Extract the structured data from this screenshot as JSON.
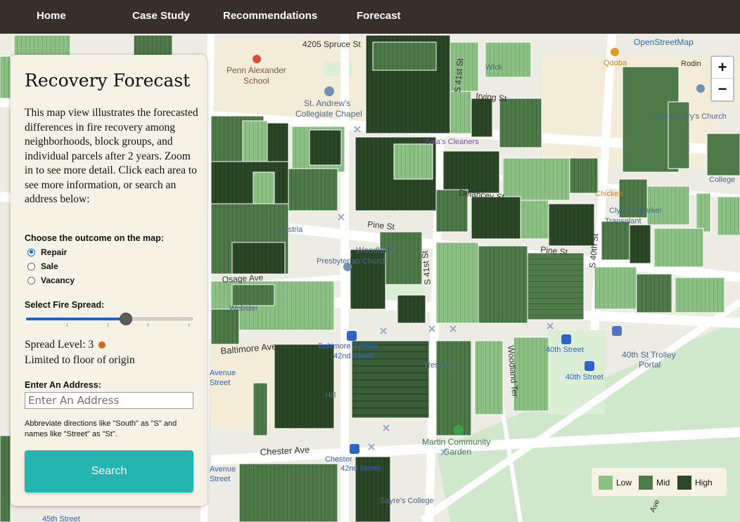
{
  "nav": {
    "home": "Home",
    "case_study": "Case Study",
    "recommendations": "Recommendations",
    "forecast": "Forecast"
  },
  "map": {
    "attribution": "OpenStreetMap",
    "zoom_in": "+",
    "zoom_out": "−",
    "labels": {
      "spruce": "4205 Spruce St",
      "penn_alexander": "Penn Alexander",
      "school": "School",
      "st_andrews": "St. Andrew's",
      "collegiate_chapel": "Collegiate Chapel",
      "s41_north": "S 41st St",
      "irving": "Irving St",
      "saias": "Saia's Cleaners",
      "delancey": "Delancey St",
      "pine_left": "Pine St",
      "pine_right": "Pine St",
      "woodland": "Woodland",
      "presbyterian": "Presbyterian Church",
      "s41_mid": "S 41st St",
      "s40": "S 40th St",
      "osage": "Osage Ave",
      "baltimore": "Baltimore Ave",
      "baltimore_42": "Baltimore Avenue",
      "baltimore_42b": "42nd Street",
      "woodland_ter": "Woodland Ter",
      "st40_top": "40th Street",
      "st40_bottom": "40th Street",
      "trolley": "40th St Trolley",
      "portal": "Portal",
      "chester": "Chester Ave",
      "chester_42": "Chester",
      "chester_42b": "42nd Street",
      "martin": "Martin Community",
      "garden": "Garden",
      "college": "Sayre's College",
      "qdoba": "Qdoba",
      "rodin": "Rodin",
      "st_marys": "Saint Mary's Church",
      "college_r": "College",
      "clyde": "Clyde F. Barker",
      "transplant": "Transplant",
      "avenue_l": "Avenue",
      "street_l": "Street",
      "avenue_l2": "Avenue",
      "street_l2": "Street",
      "street_bottom": "45th Street",
      "ave_bot": "Ave",
      "webs": "Webster",
      "resc": "Rescue",
      "hill": "Hill",
      "kwick": "Wick",
      "chicken": "Chicken",
      "ustria": "Austria"
    }
  },
  "panel": {
    "title": "Recovery Forecast",
    "description": "This map view illustrates the forecasted differences in fire recovery among neighborhoods, block groups, and individual parcels after 2 years. Zoom in to see more detail. Click each area to see more information, or search an address below:",
    "outcome_label": "Choose the outcome on the map:",
    "outcomes": [
      "Repair",
      "Sale",
      "Vacancy"
    ],
    "selected_outcome": "Repair",
    "spread_label": "Select Fire Spread:",
    "spread_value": 3,
    "spread_min": 0,
    "spread_max": 5,
    "spread_level_text": "Spread Level: 3",
    "spread_color": "#d2691e",
    "spread_description": "Limited to floor of origin",
    "address_label": "Enter An Address:",
    "address_placeholder": "Enter An Address",
    "hint": "Abbreviate directions like \"South\" as \"S\" and names like \"Street\" as \"St\".",
    "search_label": "Search"
  },
  "legend": {
    "items": [
      {
        "label": "Low",
        "color": "#8cc084"
      },
      {
        "label": "Mid",
        "color": "#4d7a48"
      },
      {
        "label": "High",
        "color": "#2b4728"
      }
    ]
  }
}
